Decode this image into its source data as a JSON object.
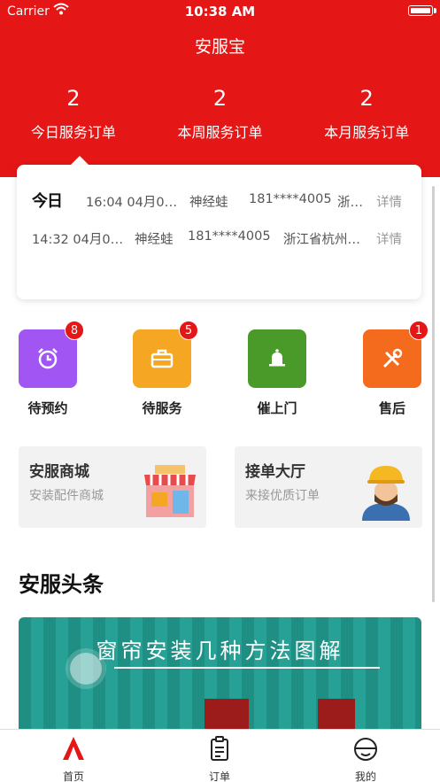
{
  "status_bar": {
    "carrier": "Carrier",
    "time": "10:38 AM"
  },
  "app": {
    "title": "安服宝"
  },
  "stats": [
    {
      "value": "2",
      "label": "今日服务订单"
    },
    {
      "value": "2",
      "label": "本周服务订单"
    },
    {
      "value": "2",
      "label": "本月服务订单"
    }
  ],
  "today_card": {
    "logo": "今日",
    "rows": [
      {
        "time": "16:04 04月0…",
        "name": "神经蛙",
        "phone": "181****4005",
        "address": "浙…",
        "detail": "详情"
      },
      {
        "time": "14:32 04月0…",
        "name": "神经蛙",
        "phone": "181****4005",
        "address": "浙江省杭州…",
        "detail": "详情"
      }
    ]
  },
  "actions": [
    {
      "label": "待预约",
      "badge": "8",
      "icon": "alarm-clock-icon",
      "color": "#a155f2"
    },
    {
      "label": "待服务",
      "badge": "5",
      "icon": "toolbox-icon",
      "color": "#f5a623"
    },
    {
      "label": "催上门",
      "badge": "",
      "icon": "bell-icon",
      "color": "#4a9a2a"
    },
    {
      "label": "售后",
      "badge": "1",
      "icon": "tools-icon",
      "color": "#f56b1e"
    }
  ],
  "tiles": [
    {
      "title": "安服商城",
      "subtitle": "安装配件商城",
      "icon": "store-icon"
    },
    {
      "title": "接单大厅",
      "subtitle": "来接优质订单",
      "icon": "worker-icon"
    }
  ],
  "news": {
    "section_title": "安服头条",
    "banner_title": "窗帘安装几种方法图解"
  },
  "tabbar": [
    {
      "label": "首页",
      "icon": "home-logo-icon",
      "active": true
    },
    {
      "label": "订单",
      "icon": "clipboard-icon",
      "active": false
    },
    {
      "label": "我的",
      "icon": "helmet-icon",
      "active": false
    }
  ],
  "colors": {
    "brand": "#e41616",
    "badge": "#e41616"
  }
}
